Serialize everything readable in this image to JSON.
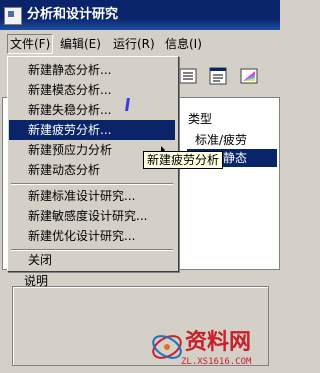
{
  "window": {
    "title": "分析和设计研究"
  },
  "menubar": {
    "items": [
      {
        "label": "文件(F)"
      },
      {
        "label": "编辑(E)"
      },
      {
        "label": "运行(R)"
      },
      {
        "label": "信息(I)"
      }
    ]
  },
  "file_menu": {
    "items": [
      {
        "label": "新建静态分析..."
      },
      {
        "label": "新建模态分析..."
      },
      {
        "label": "新建失稳分析..."
      },
      {
        "label": "新建疲劳分析...",
        "state": "highlighted"
      },
      {
        "label": "新建预应力分析",
        "submenu": true
      },
      {
        "label": "新建动态分析"
      },
      {
        "label": "新建标准设计研究..."
      },
      {
        "label": "新建敏感度设计研究..."
      },
      {
        "label": "新建优化设计研究..."
      },
      {
        "label": "关闭"
      }
    ]
  },
  "table": {
    "column_header": "类型",
    "rows": [
      {
        "type": "标准/疲劳"
      },
      {
        "type": "标准/静态",
        "selected": true
      }
    ]
  },
  "tooltip": {
    "text": "新建疲劳分析"
  },
  "description": {
    "label": "说明"
  },
  "watermark": {
    "brand": "资料网",
    "url": "ZL.XS1616.COM"
  },
  "colors": {
    "selection": "#0a246a",
    "title_bar": "#0a246a",
    "face": "#d4d0c8",
    "watermark": "#c8202a"
  },
  "toolbar": {
    "icons": [
      "list-icon",
      "report-icon",
      "color-palette-icon"
    ]
  }
}
